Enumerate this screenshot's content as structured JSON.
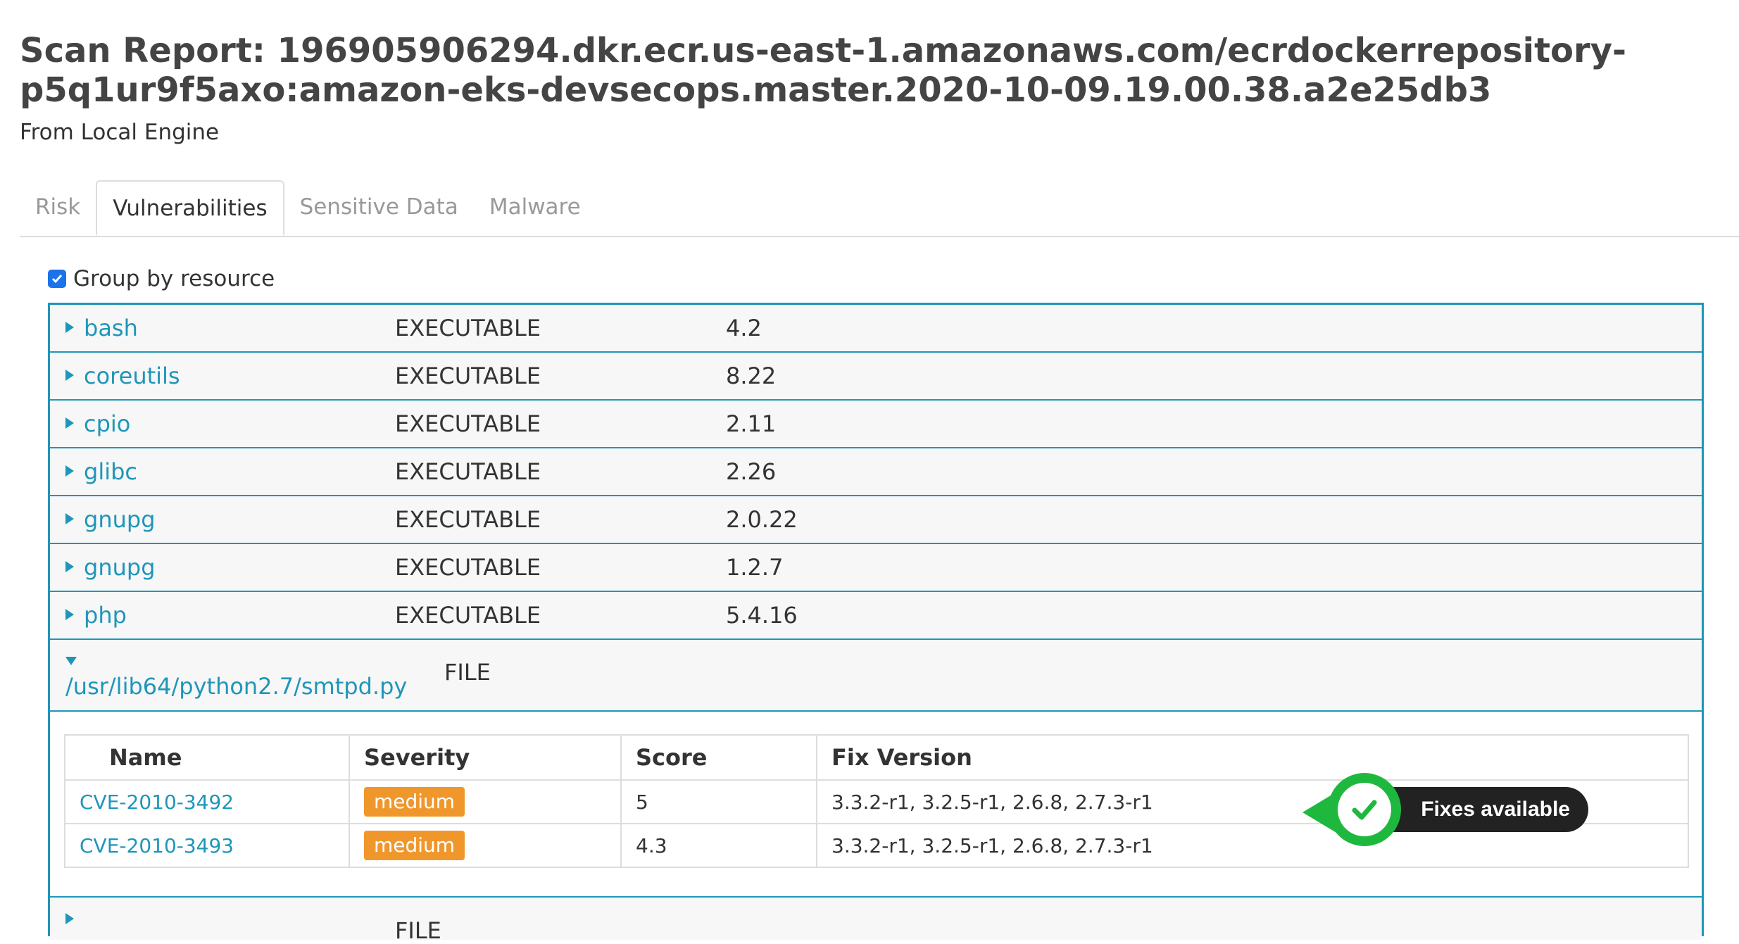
{
  "header": {
    "title": "Scan Report: 196905906294.dkr.ecr.us-east-1.amazonaws.com/ecrdockerrepository-p5q1ur9f5axo:amazon-eks-devsecops.master.2020-10-09.19.00.38.a2e25db3",
    "subtitle": "From Local Engine"
  },
  "tabs": [
    {
      "label": "Risk",
      "active": false
    },
    {
      "label": "Vulnerabilities",
      "active": true
    },
    {
      "label": "Sensitive Data",
      "active": false
    },
    {
      "label": "Malware",
      "active": false
    }
  ],
  "group_by": {
    "label": "Group by resource",
    "checked": true
  },
  "resources": [
    {
      "name": "bash",
      "type": "EXECUTABLE",
      "version": "4.2"
    },
    {
      "name": "coreutils",
      "type": "EXECUTABLE",
      "version": "8.22"
    },
    {
      "name": "cpio",
      "type": "EXECUTABLE",
      "version": "2.11"
    },
    {
      "name": "glibc",
      "type": "EXECUTABLE",
      "version": "2.26"
    },
    {
      "name": "gnupg",
      "type": "EXECUTABLE",
      "version": "2.0.22"
    },
    {
      "name": "gnupg",
      "type": "EXECUTABLE",
      "version": "1.2.7"
    },
    {
      "name": "php",
      "type": "EXECUTABLE",
      "version": "5.4.16"
    }
  ],
  "expanded_resource": {
    "name": "/usr/lib64/python2.7/smtpd.py",
    "type": "FILE",
    "columns": [
      "Name",
      "Severity",
      "Score",
      "Fix Version"
    ],
    "rows": [
      {
        "name": "CVE-2010-3492",
        "severity": "medium",
        "score": "5",
        "fix": "3.3.2-r1, 3.2.5-r1, 2.6.8, 2.7.3-r1"
      },
      {
        "name": "CVE-2010-3493",
        "severity": "medium",
        "score": "4.3",
        "fix": "3.3.2-r1, 3.2.5-r1, 2.6.8, 2.7.3-r1"
      }
    ]
  },
  "next_resource": {
    "type": "FILE"
  },
  "callout": {
    "label": "Fixes available"
  },
  "colors": {
    "accent": "#1e96b9",
    "severity_medium": "#f0972c",
    "callout_green": "#1fb83f"
  }
}
